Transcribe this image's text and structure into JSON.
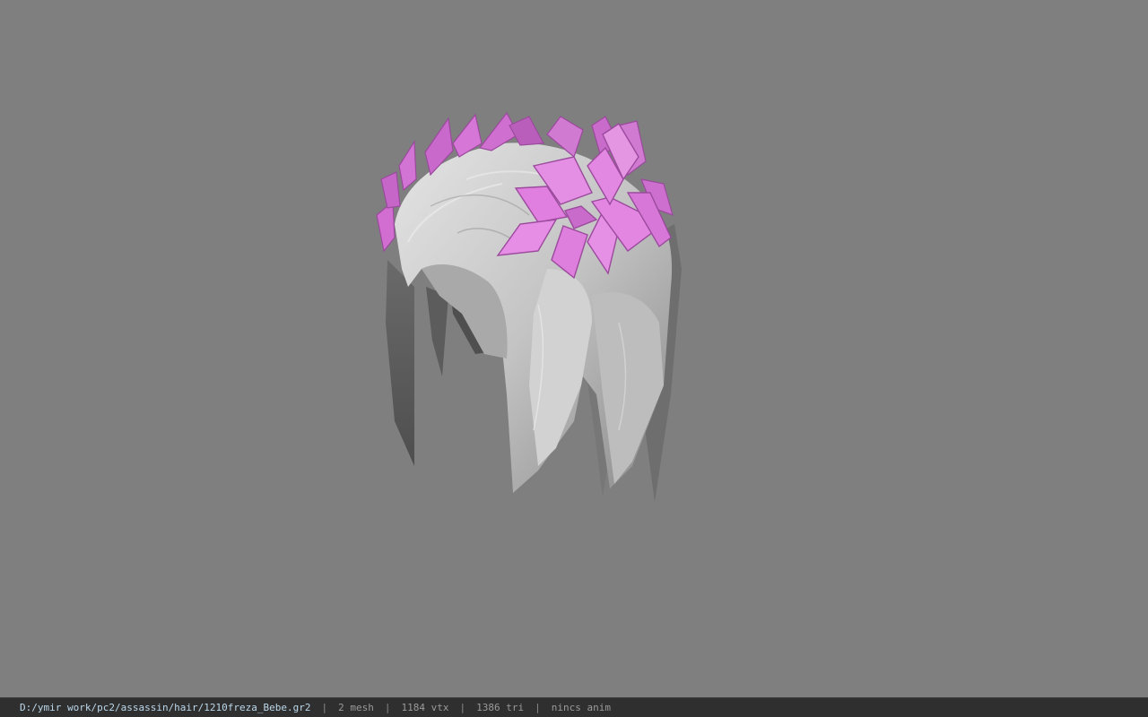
{
  "viewport": {
    "background_color": "#7f7f7f",
    "model": {
      "hair_color": "#c8c8c8",
      "wreath_leaf_color": "#e07fdf",
      "wreath_leaf_shadow": "#9b4a9d"
    }
  },
  "statusbar": {
    "file_path": "D:/ymir work/pc2/assassin/hair/1210freza_Bebe.gr2",
    "separator": "|",
    "mesh_count": "2 mesh",
    "vertex_count": "1184 vtx",
    "triangle_count": "1386 tri",
    "animation": "nincs anim"
  }
}
